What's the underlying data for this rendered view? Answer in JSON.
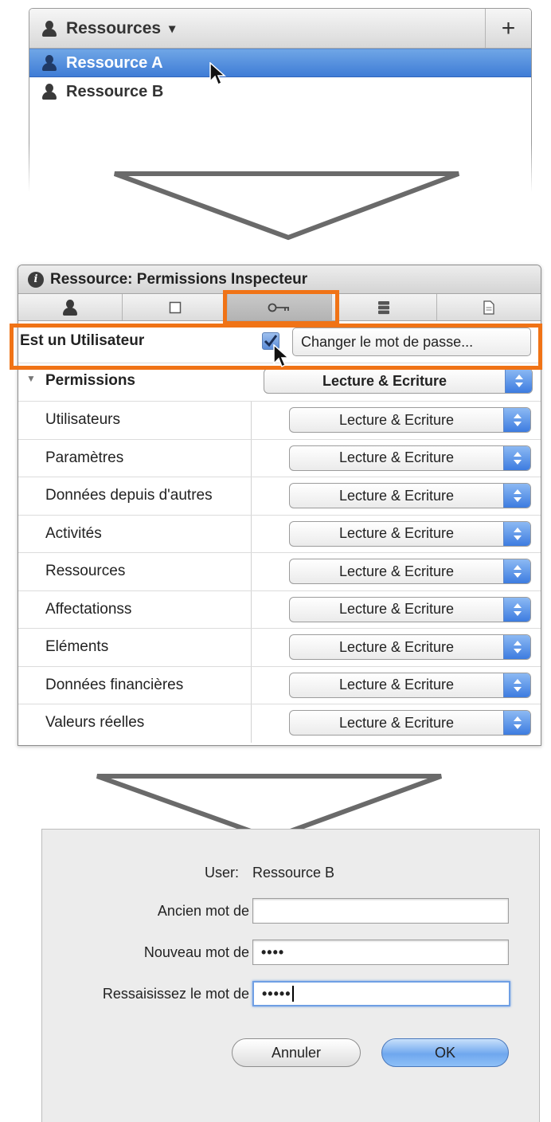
{
  "resources_panel": {
    "title": "Ressources",
    "dropdown_arrow": "▾",
    "add_label": "+",
    "items": [
      {
        "label": "Ressource A",
        "selected": true
      },
      {
        "label": "Ressource B",
        "selected": false
      }
    ]
  },
  "inspector": {
    "title": "Ressource: Permissions Inspecteur",
    "tab_icons": [
      "person-icon",
      "square-icon",
      "key-icon",
      "database-icon",
      "document-icon"
    ],
    "active_tab": 2,
    "user_row": {
      "label": "Est un Utilisateur",
      "checked": true,
      "change_password_label": "Changer le mot de passe..."
    },
    "permissions_group": {
      "label": "Permissions",
      "value": "Lecture & Ecriture"
    },
    "permissions": [
      {
        "label": "Utilisateurs",
        "value": "Lecture & Ecriture"
      },
      {
        "label": "Paramètres",
        "value": "Lecture & Ecriture"
      },
      {
        "label": "Données depuis d'autres",
        "value": "Lecture & Ecriture"
      },
      {
        "label": "Activités",
        "value": "Lecture & Ecriture"
      },
      {
        "label": "Ressources",
        "value": "Lecture & Ecriture"
      },
      {
        "label": "Affectationss",
        "value": "Lecture & Ecriture"
      },
      {
        "label": "Eléments",
        "value": "Lecture & Ecriture"
      },
      {
        "label": "Données financières",
        "value": "Lecture & Ecriture"
      },
      {
        "label": "Valeurs réelles",
        "value": "Lecture & Ecriture"
      }
    ]
  },
  "password_dialog": {
    "user_label": "User:",
    "user_value": "Ressource B",
    "old_label": "Ancien mot de",
    "old_value": "",
    "new_label": "Nouveau mot de",
    "new_value": "••••",
    "confirm_label": "Ressaisissez le mot de",
    "confirm_value": "•••••",
    "cancel_label": "Annuler",
    "ok_label": "OK"
  },
  "colors": {
    "highlight": "#f07316",
    "selection": "#3f7cd6",
    "arrow_stroke": "#6a6a6a"
  }
}
